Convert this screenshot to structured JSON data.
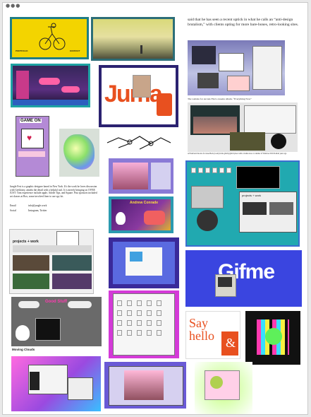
{
  "window": {
    "title_dots": "●●●"
  },
  "article": {
    "paragraph_top": "said that he has seen a recent uptick in what he calls an “anti-design brutalism,” with clients opting for more bare-bones, retro-looking sites.",
    "caption_1": "The website for Arcade Fire's cassette album, “Everything Now”",
    "caption_2": "A Flash/web the site for Jesse Beck (room) in the glitchy/glitch place with a Joshua tree or consider of Windows 95/CD-Rom years ago",
    "bio_text": "Jungle Fest is a graphic designer based in New York. It's the work he loves discussion with Geekfairy, amidst the detail with a helpful tool. It is merely bringing on OVER JUST: Tom experience include apple, Adobe Tips, and Square. Past sponsors included art classes at Box, some involved liner to use spy lot.",
    "bio_email_label": "Email",
    "bio_email": "info@jungle.work",
    "bio_social_label": "Social",
    "bio_social": "Instagram, Twitter"
  },
  "tiles": {
    "portfolio_left": "PORTFOLIO",
    "portfolio_right": "KONTAKT",
    "juma_text": "Juma",
    "game_on": "GAME ON",
    "projects_title": "projects + work",
    "ambient_title": "Andrew Conrade",
    "gifme_text": "Gifme",
    "say_hello_1": "Say",
    "say_hello_2": "hello",
    "say_hello_amp": "&",
    "moving_clouds": "Moving Clouds",
    "sticker_text": "Good Stuff"
  },
  "colors": {
    "yellow": "#f3d400",
    "teal": "#2a8f8f",
    "juma_red": "#e8501f",
    "gifme_blue": "#3a45e0",
    "purple": "#6b3fc7",
    "magenta": "#d43ad8"
  }
}
